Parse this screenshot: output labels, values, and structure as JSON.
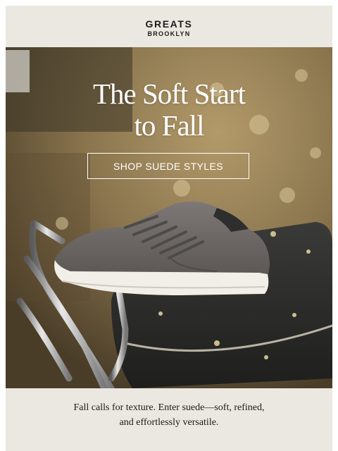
{
  "header": {
    "brand_line1": "GREATS",
    "brand_line2": "BROOKLYN"
  },
  "hero": {
    "headline_line1": "The Soft Start",
    "headline_line2": "to Fall",
    "cta_label": "SHOP SUEDE STYLES",
    "image_subject": "grey suede sneaker on a scooter seat with chrome rack"
  },
  "body": {
    "line1": "Fall calls for texture. Enter suede—soft, refined,",
    "line2": "and effortlessly versatile."
  },
  "colors": {
    "background": "#ebe8e1",
    "text": "#1a1a1a",
    "hero_text": "#ffffff"
  }
}
